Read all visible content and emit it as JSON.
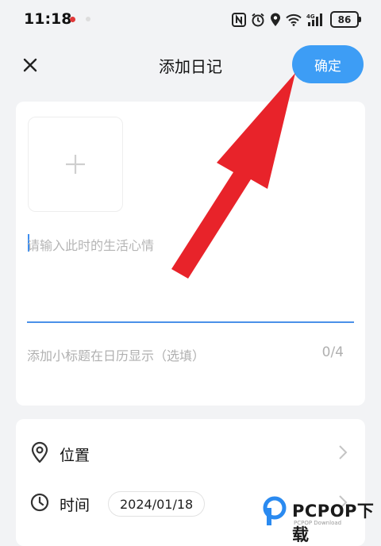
{
  "status": {
    "time": "11:18",
    "network": "4G",
    "battery": "86"
  },
  "header": {
    "title": "添加日记",
    "confirm_label": "确定"
  },
  "editor": {
    "mood_placeholder": "请输入此时的生活心情",
    "subtitle_placeholder": "添加小标题在日历显示（选填）",
    "subtitle_count": "0/4"
  },
  "info": {
    "location_label": "位置",
    "time_label": "时间",
    "date_value": "2024/01/18"
  },
  "watermark": {
    "brand": "PCPOP下载",
    "sub": "PCPOP Download"
  },
  "colors": {
    "accent": "#3d9df5",
    "arrow": "#e8232a"
  },
  "icons": [
    "close-icon",
    "plus-icon",
    "location-pin-icon",
    "clock-icon",
    "chevron-right-icon",
    "wifi-icon",
    "signal-icon",
    "alarm-icon",
    "nfc-icon"
  ]
}
